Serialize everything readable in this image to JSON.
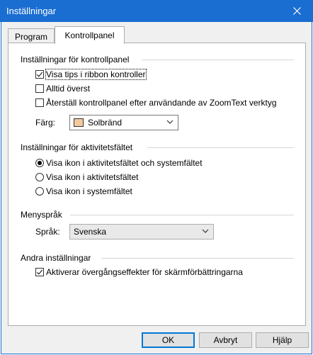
{
  "window": {
    "title": "Inställningar"
  },
  "tabs": [
    {
      "label": "Program"
    },
    {
      "label": "Kontrollpanel"
    }
  ],
  "control_panel": {
    "title": "Inställningar för kontrollpanel",
    "show_tips": {
      "label": "Visa tips i ribbon kontroller",
      "checked": true
    },
    "always_on_top": {
      "label": "Alltid överst",
      "checked": false
    },
    "restore_panel": {
      "label": "Återställ kontrollpanel efter användande av ZoomText verktyg",
      "checked": false
    },
    "color_label": "Färg:",
    "color_value": "Solbränd",
    "swatch_color": "#f5c9a0"
  },
  "taskbar": {
    "title": "Inställningar för aktivitetsfältet",
    "options": [
      {
        "label": "Visa ikon i aktivitetsfältet och systemfältet",
        "selected": true
      },
      {
        "label": "Visa ikon i aktivitetsfältet",
        "selected": false
      },
      {
        "label": "Visa ikon i systemfältet",
        "selected": false
      }
    ]
  },
  "menu_language": {
    "title": "Menyspråk",
    "language_label": "Språk:",
    "language_value": "Svenska"
  },
  "other": {
    "title": "Andra inställningar",
    "transition": {
      "label": "Aktiverar övergångseffekter för skärmförbättringarna",
      "checked": true
    }
  },
  "buttons": {
    "ok": "OK",
    "cancel": "Avbryt",
    "help": "Hjälp"
  }
}
